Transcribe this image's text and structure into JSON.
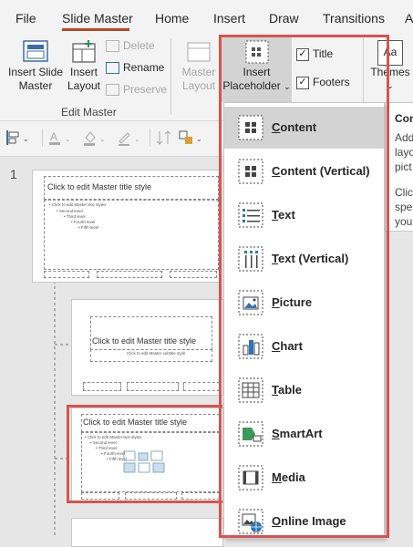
{
  "tabs": [
    "File",
    "Slide Master",
    "Home",
    "Insert",
    "Draw",
    "Transitions",
    "A"
  ],
  "ribbon": {
    "insert_slide_master": [
      "Insert Slide",
      "Master"
    ],
    "insert_layout": [
      "Insert",
      "Layout"
    ],
    "delete": "Delete",
    "rename": "Rename",
    "preserve": "Preserve",
    "edit_master_group": "Edit Master",
    "master_layout": [
      "Master",
      "Layout"
    ],
    "insert_placeholder": [
      "Insert",
      "Placeholder"
    ],
    "title_label": "Title",
    "footers_label": "Footers",
    "themes": "Themes",
    "themes_aa": "Aa"
  },
  "left_pane": {
    "slide_number": "1",
    "thumb1": {
      "title": "Click to edit Master title style",
      "lines": [
        "• Click to edit Master text styles",
        "• Second level",
        "• Third level",
        "• Fourth level",
        "• Fifth level"
      ]
    },
    "thumb2": {
      "title": "Click to edit Master title style",
      "subtitle": "Click to edit Master subtitle style"
    },
    "thumb3": {
      "title": "Click to edit Master title style",
      "lines": [
        "• Click to edit Master text styles",
        "• Second level",
        "• Third level",
        "• Fourth level",
        "• Fifth level"
      ]
    }
  },
  "dropdown": {
    "items": [
      {
        "label": "Content",
        "icon": "content-icon",
        "highlighted": true
      },
      {
        "label": "Content (Vertical)",
        "icon": "content-vertical-icon"
      },
      {
        "label": "Text",
        "icon": "text-icon"
      },
      {
        "label": "Text (Vertical)",
        "icon": "text-vertical-icon"
      },
      {
        "label": "Picture",
        "icon": "picture-icon"
      },
      {
        "label": "Chart",
        "icon": "chart-icon"
      },
      {
        "label": "Table",
        "icon": "table-icon"
      },
      {
        "label": "SmartArt",
        "icon": "smartart-icon"
      },
      {
        "label": "Media",
        "icon": "media-icon"
      },
      {
        "label": "Online Image",
        "icon": "online-image-icon"
      }
    ]
  },
  "tooltip": {
    "title": "Con",
    "lines": [
      "Add",
      "layo",
      "pict",
      "",
      "Clic",
      "spec",
      "you"
    ]
  },
  "colors": {
    "accent": "#b7472a",
    "highlight_box": "#d9534f"
  }
}
